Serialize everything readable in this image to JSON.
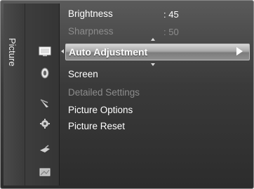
{
  "menu": {
    "category": "Picture",
    "items": [
      {
        "label": "Brightness",
        "value": ": 45",
        "enabled": true
      },
      {
        "label": "Sharpness",
        "value": ": 50",
        "enabled": false
      },
      {
        "label": "Auto Adjustment",
        "value": "",
        "enabled": true,
        "selected": true
      },
      {
        "label": "Screen",
        "value": "",
        "enabled": true
      },
      {
        "label": "Detailed Settings",
        "value": "",
        "enabled": false
      },
      {
        "label": "Picture Options",
        "value": "",
        "enabled": true
      },
      {
        "label": "Picture Reset",
        "value": "",
        "enabled": true
      }
    ]
  },
  "icons": [
    {
      "name": "picture-icon",
      "active": true
    },
    {
      "name": "sound-icon",
      "active": false
    },
    {
      "name": "channel-icon",
      "active": false
    },
    {
      "name": "setup-icon",
      "active": false
    },
    {
      "name": "input-icon",
      "active": false
    },
    {
      "name": "application-icon",
      "active": false
    }
  ],
  "colors": {
    "panel": "#3a3a3a",
    "highlight": "#a8a8a8",
    "text": "#ffffff",
    "dim_text": "#8c8c8c"
  }
}
